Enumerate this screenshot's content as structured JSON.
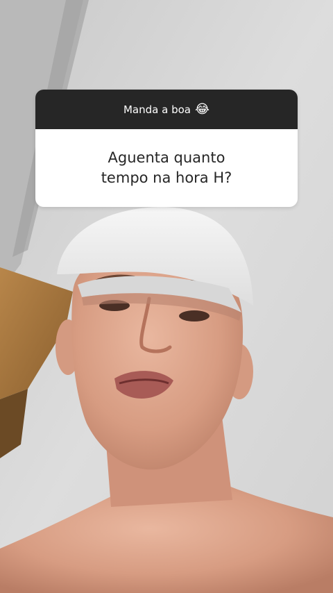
{
  "question_sticker": {
    "prompt": "Manda a boa",
    "emoji": "😂",
    "question": "Aguenta quanto tempo na hora H?"
  },
  "background": {
    "type": "front-camera-photo",
    "subject": "person-with-white-cap"
  }
}
